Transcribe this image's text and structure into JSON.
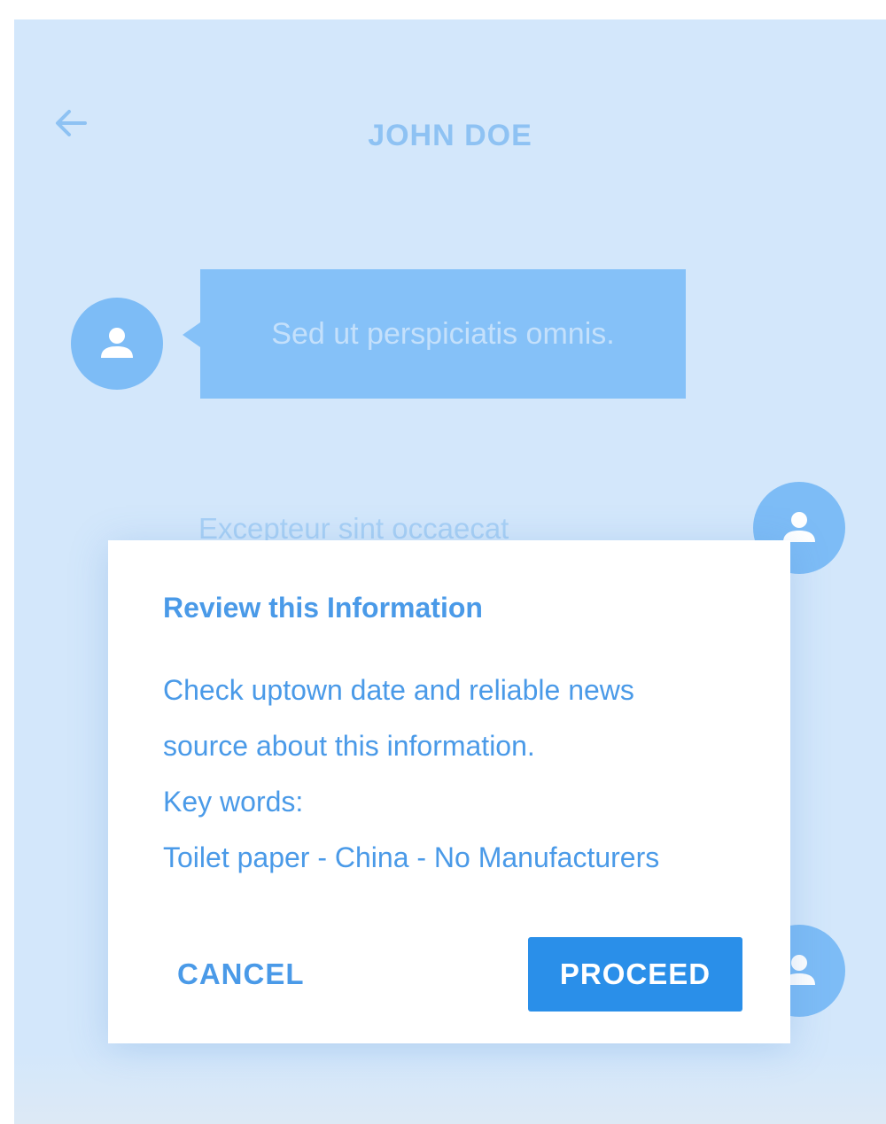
{
  "header": {
    "title": "JOHN DOE",
    "back_icon": "arrow-left-icon"
  },
  "messages": [
    {
      "direction": "incoming",
      "text": "Sed ut perspiciatis omnis.",
      "avatar_icon": "person-icon"
    },
    {
      "direction": "outgoing",
      "text": "Excepteur sint occaecat",
      "avatar_icon": "person-icon"
    },
    {
      "direction": "outgoing",
      "text": "",
      "avatar_icon": "person-icon"
    }
  ],
  "dialog": {
    "title": "Review this Information",
    "lines": [
      "Check uptown date and reliable news",
      "source about this information.",
      "Key words:",
      "Toilet paper - China - No Manufacturers"
    ],
    "cancel_label": "CANCEL",
    "proceed_label": "PROCEED"
  },
  "colors": {
    "background": "#d3e7fb",
    "accent": "#2a8fe9",
    "bubble": "#85c1f8",
    "avatar": "#7dbcf6",
    "text_blue": "#4a9ae8"
  }
}
